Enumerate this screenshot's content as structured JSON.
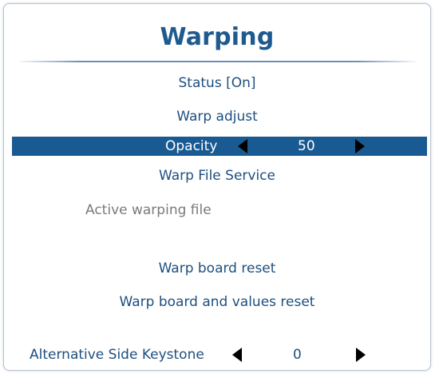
{
  "menu": {
    "title": "Warping",
    "status": "Status [On]",
    "warp_adjust": "Warp adjust",
    "opacity": {
      "label": "Opacity",
      "value": "50"
    },
    "warp_file_service": "Warp File Service",
    "active_warping_file": "Active warping file",
    "warp_board_reset": "Warp board reset",
    "warp_board_values_reset": "Warp board and values reset",
    "alternative_side_keystone": {
      "label": "Alternative Side Keystone",
      "value": "0"
    }
  },
  "colors": {
    "title": "#1f5a8f",
    "text": "#1d4f7f",
    "highlight_bar": "#1a5a92",
    "highlight_text": "#ffffff",
    "disabled_text": "#7a7a7a"
  },
  "icons": {
    "decrease": "triangle-left",
    "increase": "triangle-right"
  }
}
